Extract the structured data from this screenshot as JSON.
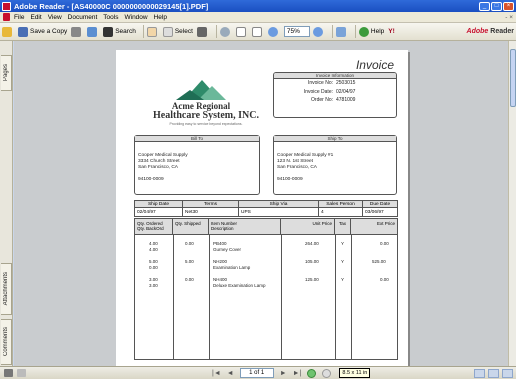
{
  "window": {
    "title": "Adobe Reader - [AS40000C 0000000000029145[1].PDF]"
  },
  "menu": {
    "items": [
      "File",
      "Edit",
      "View",
      "Document",
      "Tools",
      "Window",
      "Help"
    ],
    "right": "- ×"
  },
  "toolbar": {
    "save_copy": "Save a Copy",
    "search": "Search",
    "select": "Select",
    "zoom": "75%",
    "help": "Help",
    "brand": "Reader"
  },
  "sidebar": {
    "tabs": [
      "Pages",
      "Attachments",
      "Comments"
    ]
  },
  "invoice": {
    "title": "Invoice",
    "info_header": "Invoice Information",
    "invoice_no_label": "Invoice No:",
    "invoice_no": "2503015",
    "invoice_date_label": "Invoice Date:",
    "invoice_date": "02/04/97",
    "order_no_label": "Order No:",
    "order_no": "4781009",
    "company_line1": "Acme Regional",
    "company_line2": "Healthcare System, INC.",
    "tagline": "Providing easy to service beyond expectations.",
    "bill_to_header": "Bill To",
    "bill_to": [
      "Cooper Medical Supply",
      "3334 Church Street",
      "San Francisco, CA",
      "",
      "94100-0009"
    ],
    "ship_to_header": "Ship To",
    "ship_to": [
      "Cooper Medical Supply #1",
      "123 N. 1st Street",
      "San Francisco, CA",
      "",
      "94100-0009"
    ],
    "meta_headers": [
      "Ship Date",
      "Terms",
      "Ship Via",
      "Sales Person",
      "Due Date"
    ],
    "meta_values": [
      "02/04/97",
      "Net30",
      "UPS",
      "4",
      "03/06/97"
    ],
    "item_headers": [
      "Qty. Ordered\nQty. BackOrd",
      "Qty. Shipped",
      "Item Number\nDescription",
      "Unit Price",
      "Tax",
      "Ext Price"
    ],
    "items": [
      {
        "qty": "4.00\n4.00",
        "shipped": "0.00",
        "desc": "PB400\nGurney Cover",
        "unit": "264.00",
        "tax": "Y",
        "ext": "0.00"
      },
      {
        "qty": "5.00\n0.00",
        "shipped": "5.00",
        "desc": "NH200\nExamination Lamp",
        "unit": "105.00",
        "tax": "Y",
        "ext": "525.00"
      },
      {
        "qty": "3.00\n3.00",
        "shipped": "0.00",
        "desc": "NH400\nDeluxe Examination Lamp",
        "unit": "125.00",
        "tax": "Y",
        "ext": "0.00"
      }
    ]
  },
  "statusbar": {
    "page": "1 of 1",
    "tooltip": "8.5 x 11 in"
  }
}
